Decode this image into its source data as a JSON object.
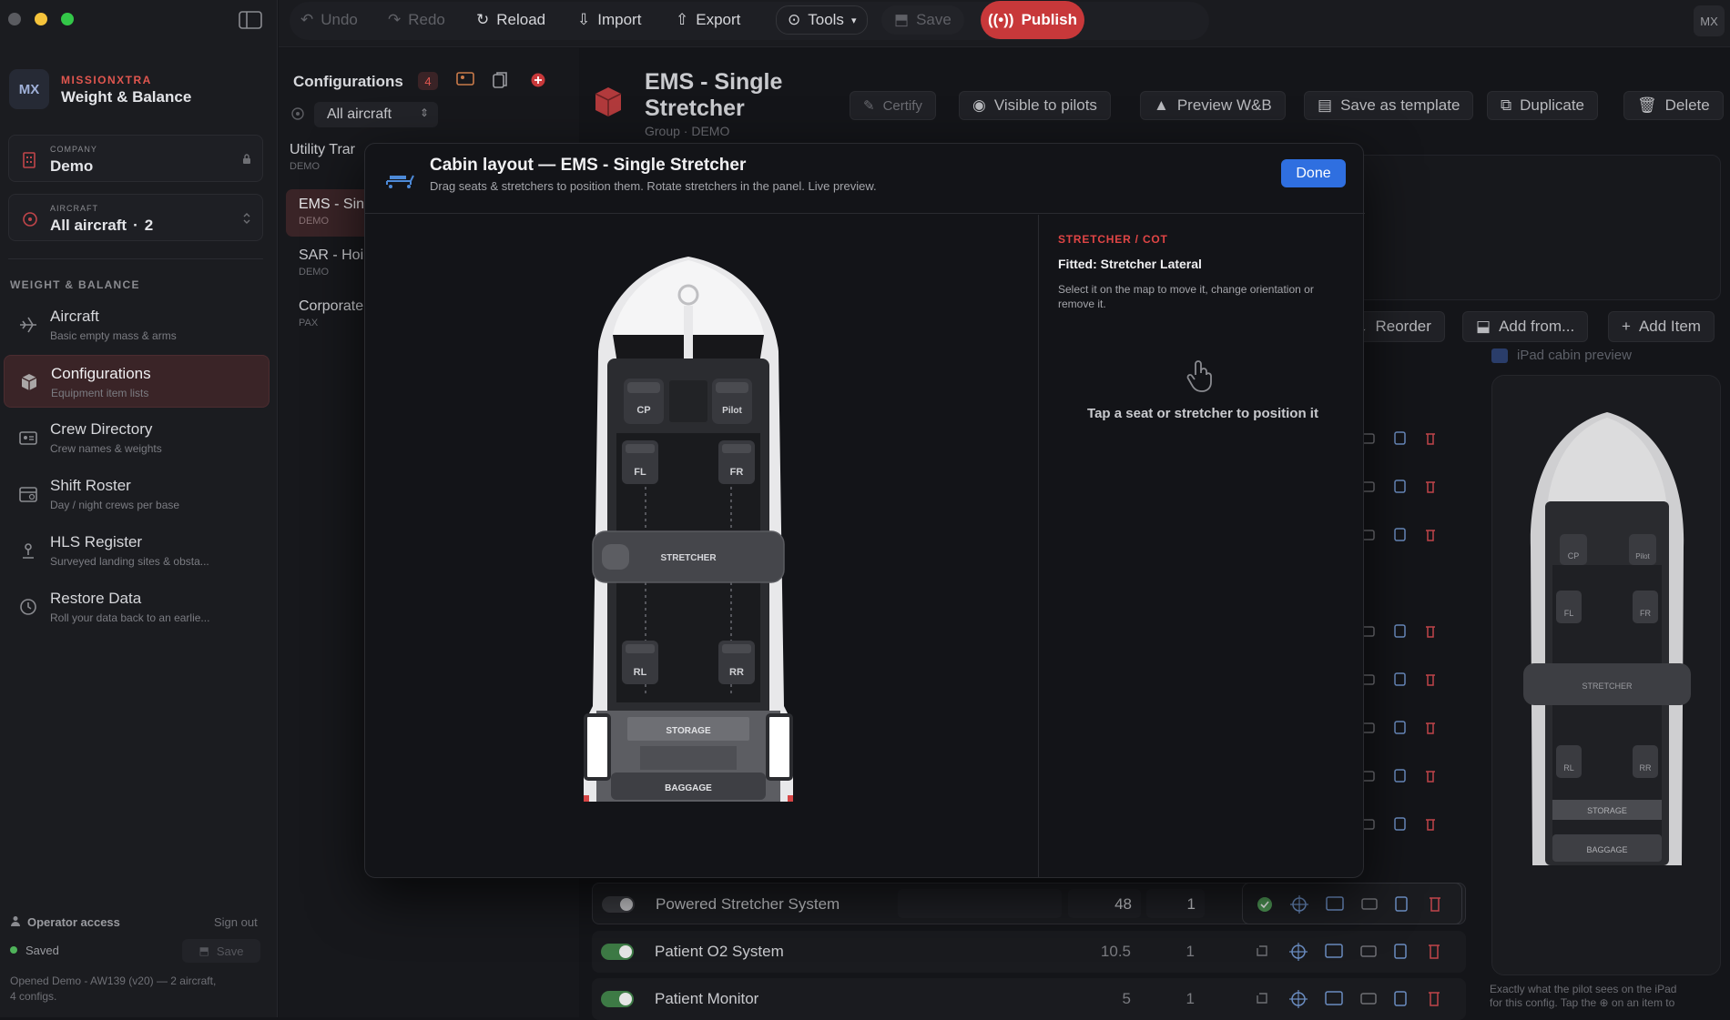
{
  "sidebar": {
    "brand_top": "MISSIONXTRA",
    "brand_sub": "Weight & Balance",
    "logo_text": "MX",
    "company_cap": "COMPANY",
    "company_value": "Demo",
    "aircraft_cap": "AIRCRAFT",
    "aircraft_value": "All aircraft",
    "aircraft_count": "2",
    "section_title": "WEIGHT & BALANCE",
    "items": [
      {
        "label": "Aircraft",
        "sub": "Basic empty mass & arms",
        "icon": "plane-icon"
      },
      {
        "label": "Configurations",
        "sub": "Equipment item lists",
        "icon": "box-icon"
      },
      {
        "label": "Crew Directory",
        "sub": "Crew names & weights",
        "icon": "id-card-icon"
      },
      {
        "label": "Shift Roster",
        "sub": "Day / night crews per base",
        "icon": "calendar-icon"
      },
      {
        "label": "HLS Register",
        "sub": "Surveyed landing sites & obsta...",
        "icon": "landing-icon"
      },
      {
        "label": "Restore Data",
        "sub": "Roll your data back to an earlie...",
        "icon": "history-icon"
      }
    ],
    "operator_label": "Operator access",
    "sign_out": "Sign out",
    "saved_label": "Saved",
    "save_btn": "Save",
    "footer_line1": "Opened Demo - AW139 (v20) — 2 aircraft,",
    "footer_line2": "4 configs."
  },
  "toolbar": {
    "undo": "Undo",
    "redo": "Redo",
    "reload": "Reload",
    "import": "Import",
    "export": "Export",
    "tools": "Tools",
    "save": "Save",
    "publish": "Publish",
    "avatar": "MX"
  },
  "configs": {
    "title": "Configurations",
    "count": "4",
    "filter": "All aircraft",
    "list": [
      {
        "name": "Utility Trar",
        "sub": "DEMO"
      },
      {
        "name": "EMS - Sin",
        "sub": "DEMO"
      },
      {
        "name": "SAR - Hoi",
        "sub": "DEMO"
      },
      {
        "name": "Corporate",
        "sub": "PAX"
      }
    ]
  },
  "header": {
    "title_line1": "EMS - Single",
    "title_line2": "Stretcher",
    "group": "Group · DEMO",
    "certify": "Certify",
    "visible": "Visible to pilots",
    "preview": "Preview W&B",
    "template": "Save as template",
    "duplicate": "Duplicate",
    "delete": "Delete"
  },
  "actions": {
    "reorder": "Reorder",
    "add_from": "Add from...",
    "add_item": "Add Item",
    "ipad_preview": "iPad cabin preview"
  },
  "modal": {
    "title": "Cabin layout — EMS - Single Stretcher",
    "subtitle": "Drag seats & stretchers to position them. Rotate stretchers in the panel. Live preview.",
    "done": "Done",
    "panel_cap": "STRETCHER / COT",
    "panel_fitted": "Fitted: Stretcher Lateral",
    "panel_desc": "Select it on the map to move it, change orientation or remove it.",
    "panel_hint": "Tap a seat or stretcher to position it"
  },
  "cabin": {
    "seats": [
      "CP",
      "Pilot",
      "FL",
      "FR",
      "RL",
      "RR"
    ],
    "stretcher": "STRETCHER",
    "storage": "STORAGE",
    "baggage": "BAGGAGE"
  },
  "items": [
    {
      "name": "Powered Stretcher System",
      "mass": "48",
      "qty": "1",
      "on": false
    },
    {
      "name": "Patient O2 System",
      "mass": "10.5",
      "qty": "1",
      "on": true
    },
    {
      "name": "Patient Monitor",
      "mass": "5",
      "qty": "1",
      "on": true
    }
  ],
  "preview_caption_1": "Exactly what the pilot sees on the iPad",
  "preview_caption_2": "for this config. Tap the ⊕ on an item to",
  "colors": {
    "accent": "#e04545",
    "publish": "#c8383a",
    "done": "#2f6fe0",
    "toggle_on": "#3d7a45"
  }
}
